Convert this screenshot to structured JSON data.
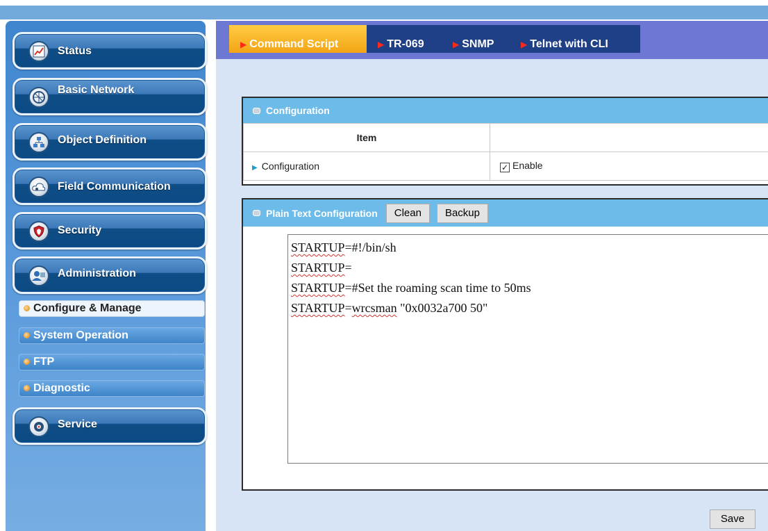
{
  "sidebar": {
    "groups": [
      {
        "label": "Status",
        "icon": "chart-icon"
      },
      {
        "label": "Basic Network",
        "icon": "network-icon"
      },
      {
        "label": "Object Definition",
        "icon": "object-icon"
      },
      {
        "label": "Field Communication",
        "icon": "cloud-icon"
      },
      {
        "label": "Security",
        "icon": "shield-icon"
      },
      {
        "label": "Administration",
        "icon": "admin-icon"
      },
      {
        "label": "Service",
        "icon": "service-icon"
      }
    ],
    "sub_items": [
      {
        "label": "Configure & Manage",
        "active": true
      },
      {
        "label": "System Operation",
        "active": false
      },
      {
        "label": "FTP",
        "active": false
      },
      {
        "label": "Diagnostic",
        "active": false
      }
    ]
  },
  "tabs": [
    {
      "label": "Command Script",
      "active": true
    },
    {
      "label": "TR-069",
      "active": false
    },
    {
      "label": "SNMP",
      "active": false
    },
    {
      "label": "Telnet with CLI",
      "active": false
    }
  ],
  "configuration_panel": {
    "title": "Configuration",
    "column_header": "Item",
    "row_label": "Configuration",
    "checkbox_label": "Enable",
    "checked": true
  },
  "plain_text_panel": {
    "title": "Plain Text Configuration",
    "clean_label": "Clean",
    "backup_label": "Backup",
    "lines": [
      {
        "key": "STARTUP",
        "rest": "=#!/bin/sh"
      },
      {
        "key": "STARTUP",
        "rest": "="
      },
      {
        "key": "STARTUP",
        "rest": "=#Set the roaming scan time to 50ms"
      },
      {
        "key": "STARTUP",
        "rest": "=",
        "extra_squig": "wrcsman",
        "tail": " \"0x0032a700 50\""
      }
    ]
  },
  "save_label": "Save",
  "colors": {
    "sidebar": "#3f86cf",
    "tab_bar": "#6d77d4",
    "active_tab": "#f3a515",
    "inactive_tab": "#1f3f86",
    "panel_header": "#6dbbe9",
    "content_bg": "#d6e4f5",
    "tab_arrow": "#ff2a1a"
  }
}
